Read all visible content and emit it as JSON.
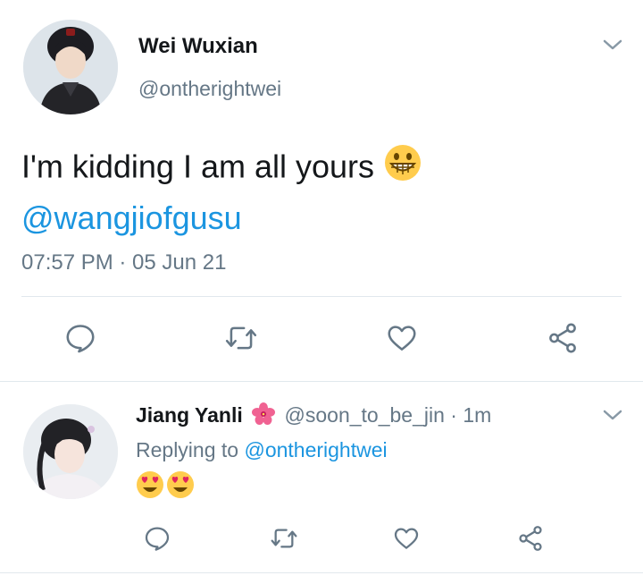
{
  "main_tweet": {
    "display_name": "Wei Wuxian",
    "handle": "@ontherightwei",
    "text": "I'm kidding I am all yours",
    "text_emoji": "grinning-face-icon",
    "mention": "@wangjiofgusu",
    "timestamp": "07:57 PM · 05 Jun 21",
    "actions": [
      "reply-icon",
      "retweet-icon",
      "like-icon",
      "share-icon"
    ]
  },
  "reply_tweet": {
    "display_name": "Jiang Yanli",
    "name_emoji": "hibiscus-icon",
    "handle": "@soon_to_be_jin",
    "time": "· 1m",
    "replying_prefix": "Replying to",
    "replying_to": "@ontherightwei",
    "emojis": [
      "heart-eyes-emoji",
      "heart-eyes-emoji"
    ],
    "actions": [
      "reply-icon",
      "retweet-icon",
      "like-icon",
      "share-icon"
    ]
  },
  "colors": {
    "link": "#1b95e0",
    "muted": "#657786",
    "text": "#14171a",
    "divider": "#e1e8ed"
  }
}
